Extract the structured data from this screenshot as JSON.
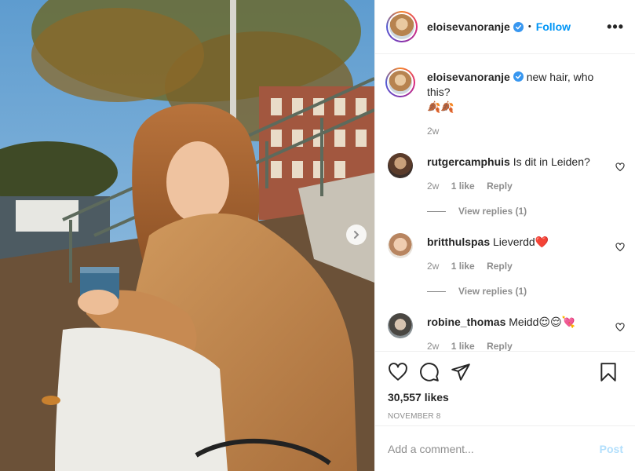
{
  "post": {
    "username": "eloisevanoranje",
    "verified": true,
    "follow_label": "Follow",
    "dot": "•",
    "more_label": "•••",
    "caption_text": "new hair, who this?",
    "caption_emoji": "🍂🍂",
    "caption_age": "2w",
    "likes_text": "30,557 likes",
    "date": "NOVEMBER 8"
  },
  "comments": [
    {
      "user": "rutgercamphuis",
      "text": "Is dit in Leiden?",
      "age": "2w",
      "likes": "1 like",
      "reply": "Reply",
      "view_replies": "View replies (1)"
    },
    {
      "user": "britthulspas",
      "text": "Lieverdd❤️",
      "age": "2w",
      "likes": "1 like",
      "reply": "Reply",
      "view_replies": "View replies (1)"
    },
    {
      "user": "robine_thomas",
      "text": "Meidd😌😌💘",
      "age": "2w",
      "likes": "1 like",
      "reply": "Reply"
    }
  ],
  "composer": {
    "placeholder": "Add a comment...",
    "post_label": "Post"
  },
  "icons": [
    "verified-badge-icon",
    "more-options-icon",
    "heart-icon",
    "comment-icon",
    "share-icon",
    "bookmark-icon",
    "chevron-right-icon"
  ],
  "colors": {
    "accent": "#0095f6",
    "muted": "#8e8e8e",
    "post_disabled": "#b2dffc"
  }
}
